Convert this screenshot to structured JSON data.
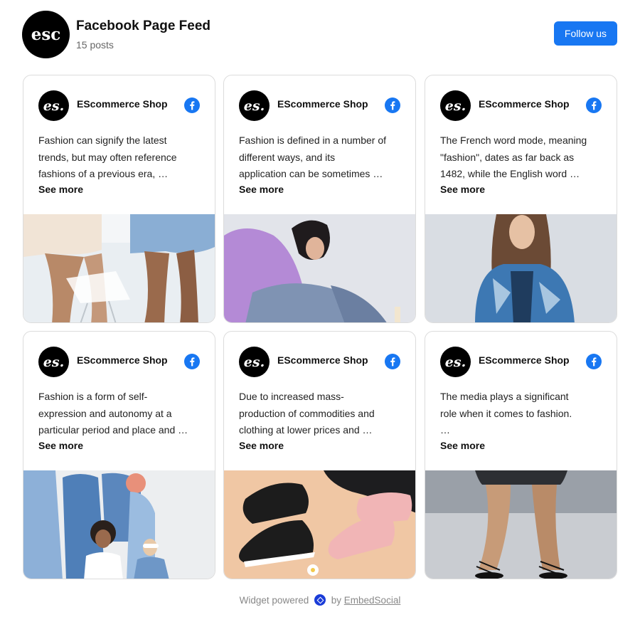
{
  "header": {
    "logo_text": "esc",
    "title": "Facebook Page Feed",
    "post_count": "15 posts",
    "follow_label": "Follow us"
  },
  "colors": {
    "brand": "#1877f2",
    "powered_badge": "#1a3cd8"
  },
  "posts": [
    {
      "avatar_text": "es.",
      "author": "EScommerce Shop",
      "network_icon": "facebook-icon",
      "lines": [
        "Fashion can signify the latest",
        "trends, but may often reference",
        "fashions of a previous era, …"
      ],
      "see_more": "See more",
      "image": "legs-sitting-photo"
    },
    {
      "avatar_text": "es.",
      "author": "EScommerce Shop",
      "network_icon": "facebook-icon",
      "lines": [
        "Fashion is defined in a number of",
        "different ways, and its",
        "application can be sometimes …"
      ],
      "see_more": "See more",
      "image": "woman-purple-jacket-photo"
    },
    {
      "avatar_text": "es.",
      "author": "EScommerce Shop",
      "network_icon": "facebook-icon",
      "lines": [
        "The French word mode, meaning",
        "\"fashion\", dates as far back as",
        "1482, while the English word …"
      ],
      "see_more": "See more",
      "image": "woman-denim-jacket-photo"
    },
    {
      "avatar_text": "es.",
      "author": "EScommerce Shop",
      "network_icon": "facebook-icon",
      "lines": [
        "Fashion is a form of self-",
        "expression and autonomy at a",
        "particular period and place and …"
      ],
      "see_more": "See more",
      "image": "group-denim-photo"
    },
    {
      "avatar_text": "es.",
      "author": "EScommerce Shop",
      "network_icon": "facebook-icon",
      "lines": [
        "Due to increased mass-",
        "production of commodities and",
        "clothing at lower prices and …"
      ],
      "see_more": "See more",
      "image": "sneakers-photo"
    },
    {
      "avatar_text": "es.",
      "author": "EScommerce Shop",
      "network_icon": "facebook-icon",
      "lines": [
        "The media plays a significant",
        "role when it comes to fashion.",
        "…"
      ],
      "see_more": "See more",
      "image": "legs-sandals-photo"
    }
  ],
  "footer": {
    "prefix": "Widget powered",
    "by": "by",
    "link": "EmbedSocial"
  }
}
